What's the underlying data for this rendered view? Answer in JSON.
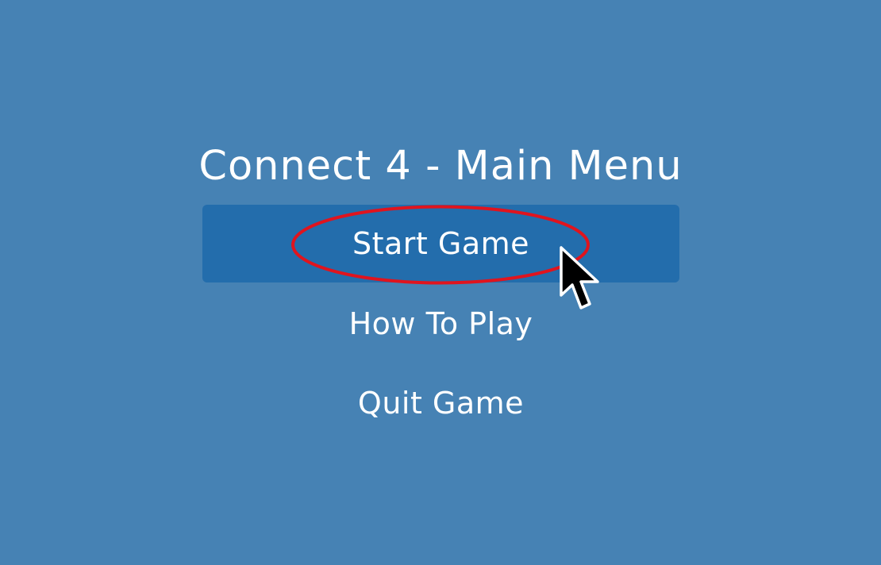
{
  "menu": {
    "title": "Connect 4 - Main Menu",
    "items": [
      {
        "label": "Start Game",
        "selected": true
      },
      {
        "label": "How To Play",
        "selected": false
      },
      {
        "label": "Quit Game",
        "selected": false
      }
    ]
  },
  "colors": {
    "background": "#4682b4",
    "selected_item": "#236dac",
    "text": "#ffffff",
    "highlight_ring": "#e0141e"
  },
  "icons": {
    "cursor": "mouse-pointer-icon"
  }
}
